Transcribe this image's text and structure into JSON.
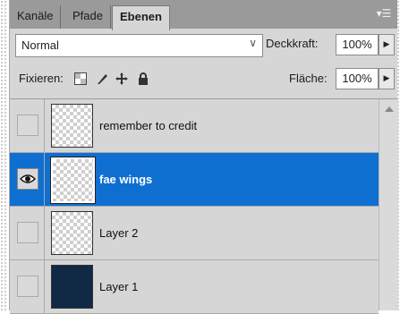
{
  "tabs": [
    {
      "label": "Kanäle",
      "active": false
    },
    {
      "label": "Pfade",
      "active": false
    },
    {
      "label": "Ebenen",
      "active": true
    }
  ],
  "blend_mode": {
    "value": "Normal"
  },
  "opacity": {
    "label": "Deckkraft:",
    "value": "100%"
  },
  "lock": {
    "label": "Fixieren:",
    "icons": [
      "lock-transparent-icon",
      "lock-image-icon",
      "lock-position-icon",
      "lock-all-icon"
    ]
  },
  "fill": {
    "label": "Fläche:",
    "value": "100%"
  },
  "layers": [
    {
      "name": "remember to credit",
      "visible": false,
      "selected": false,
      "thumb": "transparent"
    },
    {
      "name": "fae wings",
      "visible": true,
      "selected": true,
      "thumb": "transparent"
    },
    {
      "name": "Layer 2",
      "visible": false,
      "selected": false,
      "thumb": "transparent"
    },
    {
      "name": "Layer 1",
      "visible": false,
      "selected": false,
      "thumb": "solid"
    }
  ],
  "colors": {
    "selection": "#0f6fd1",
    "panel": "#d6d6d6",
    "tabbar": "#9a9a9a",
    "layer1_fill": "#102a45"
  }
}
